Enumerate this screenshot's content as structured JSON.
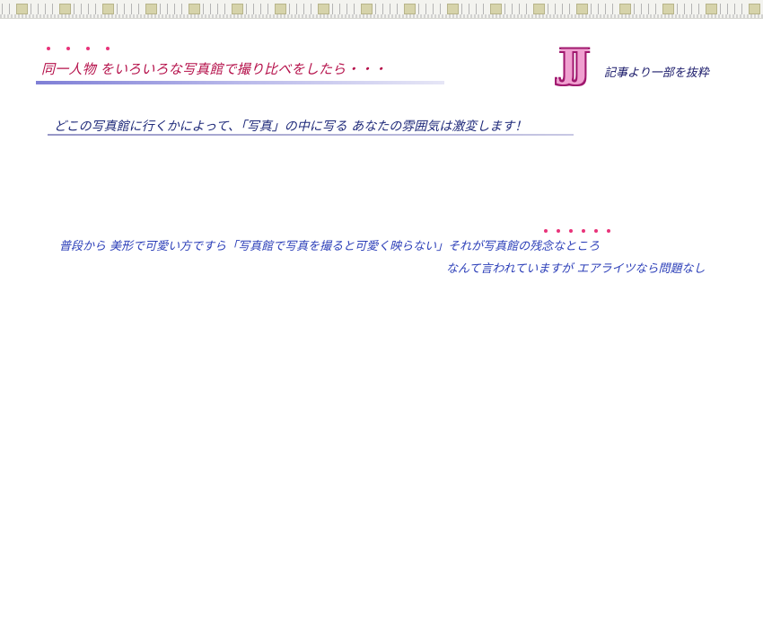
{
  "header": {
    "headline": "同一人物 をいろいろな写真館で撮り比べをしたら・・・",
    "logo_text": "JJ",
    "logo_caption": "記事より一部を抜粋"
  },
  "subhead": "どこの写真館に行くかによって、「写真」の中に写る あなたの雰囲気は激変します！",
  "body": {
    "line1": "普段から 美形で可愛い方ですら「写真館で写真を撮ると可愛く映らない」それが写真館の残念なところ",
    "line2": "なんて言われていますが エアライツなら問題なし"
  },
  "colors": {
    "headline": "#b5104a",
    "emphasis_dots": "#e8337a",
    "subhead": "#1f2a7a",
    "body": "#2b3eb8",
    "logo_fill": "#f0a0d0",
    "logo_outline": "#a0186e"
  }
}
